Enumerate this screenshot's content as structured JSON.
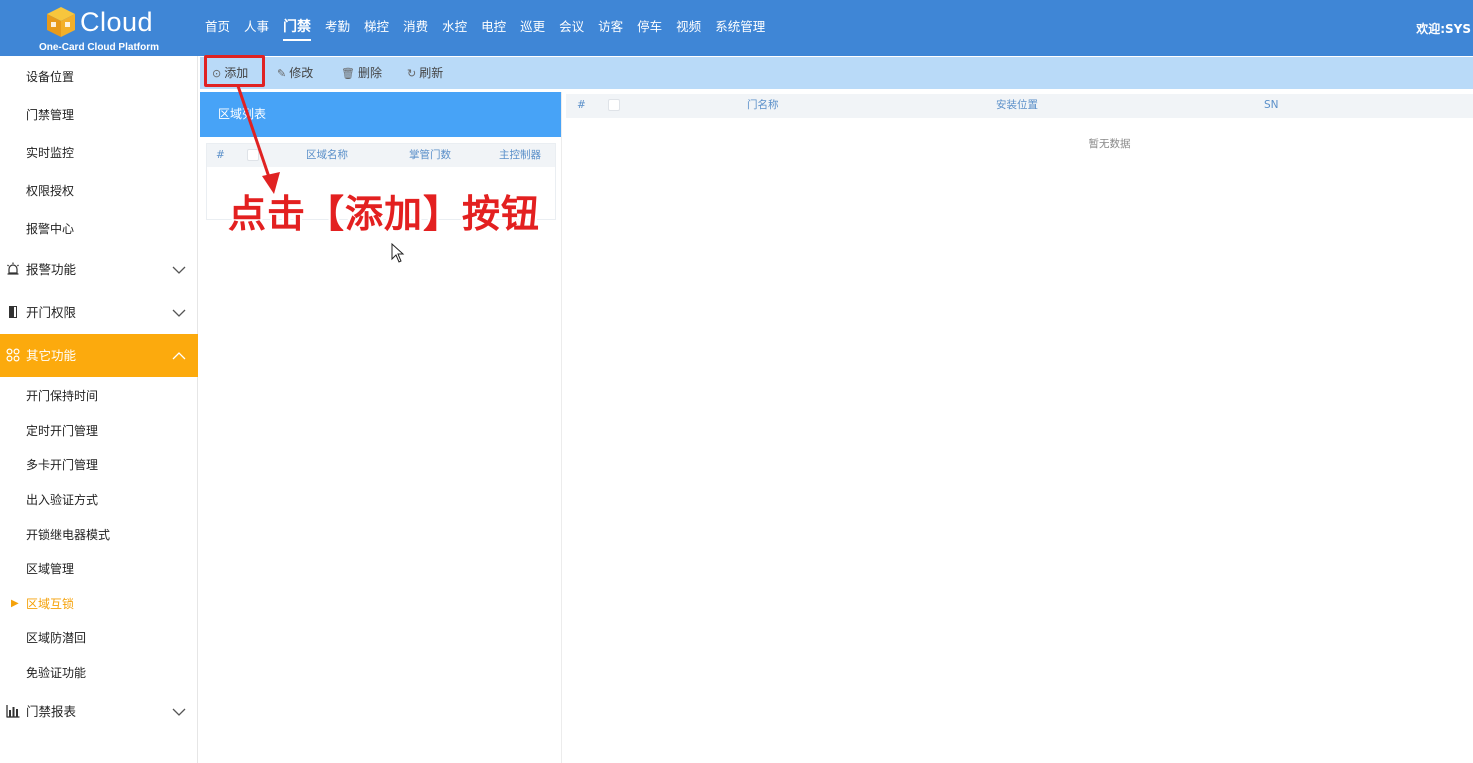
{
  "header": {
    "logo_text": "Cloud",
    "logo_subtitle": "One-Card Cloud Platform",
    "nav": [
      {
        "label": "首页"
      },
      {
        "label": "人事"
      },
      {
        "label": "门禁"
      },
      {
        "label": "考勤"
      },
      {
        "label": "梯控"
      },
      {
        "label": "消费"
      },
      {
        "label": "水控"
      },
      {
        "label": "电控"
      },
      {
        "label": "巡更"
      },
      {
        "label": "会议"
      },
      {
        "label": "访客"
      },
      {
        "label": "停车"
      },
      {
        "label": "视频"
      },
      {
        "label": "系统管理"
      }
    ],
    "active_nav": "门禁",
    "welcome": "欢迎:SYS"
  },
  "sidebar": {
    "top_items": [
      "设备位置",
      "门禁管理",
      "实时监控",
      "权限授权",
      "报警中心"
    ],
    "groups": {
      "alarm": {
        "label": "报警功能",
        "icon": "alarm-icon"
      },
      "door_permission": {
        "label": "开门权限",
        "icon": "door-icon"
      },
      "other": {
        "label": "其它功能",
        "icon": "grid-icon"
      },
      "reports": {
        "label": "门禁报表",
        "icon": "bar-chart-icon"
      }
    },
    "other_items": [
      "开门保持时间",
      "定时开门管理",
      "多卡开门管理",
      "出入验证方式",
      "开锁继电器模式",
      "区域管理",
      "区域互锁",
      "区域防潜回",
      "免验证功能"
    ],
    "current_item": "区域互锁"
  },
  "toolbar": {
    "add": "添加",
    "edit": "修改",
    "delete": "删除",
    "refresh": "刷新"
  },
  "region_panel": {
    "title": "区域列表",
    "columns": {
      "index": "#",
      "name": "区域名称",
      "doors": "掌管门数",
      "controller": "主控制器"
    }
  },
  "door_panel": {
    "columns": {
      "index": "#",
      "door_name": "门名称",
      "location": "安装位置",
      "sn": "SN"
    },
    "empty_text": "暂无数据"
  },
  "annotation": {
    "text": "点击【添加】按钮",
    "color": "#e32020"
  },
  "colors": {
    "header": "#3f86d6",
    "toolbar": "#b9daf8",
    "panel_header": "#47a3f7",
    "sidebar_active": "#fcaa0d"
  }
}
